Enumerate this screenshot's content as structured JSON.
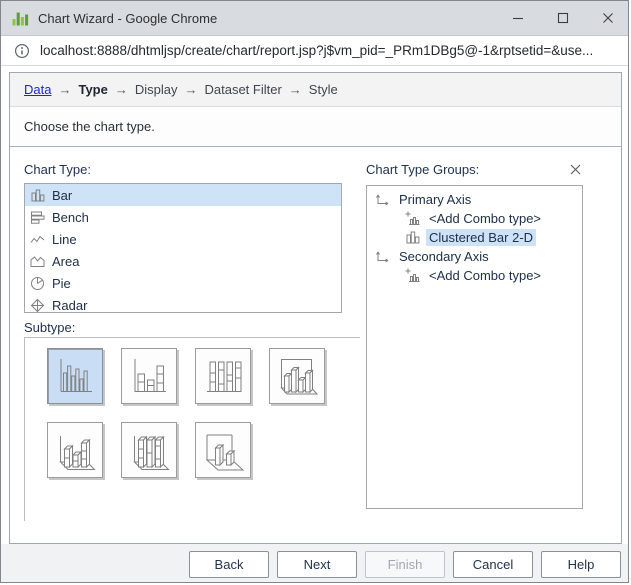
{
  "window": {
    "title": "Chart Wizard - Google Chrome",
    "favicon": "green-bar-chart-favicon",
    "controls": {
      "minimize": "minimize-icon",
      "maximize": "maximize-icon",
      "close": "close-icon"
    }
  },
  "address_bar": {
    "info_icon": "page-info-icon",
    "url": "localhost:8888/dhtmljsp/create/chart/report.jsp?j$vm_pid=_PRm1DBg5@-1&rptsetid=&use..."
  },
  "breadcrumb": {
    "separator": "→",
    "steps": [
      {
        "label": "Data",
        "state": "link"
      },
      {
        "label": "Type",
        "state": "current"
      },
      {
        "label": "Display",
        "state": "normal"
      },
      {
        "label": "Dataset Filter",
        "state": "normal"
      },
      {
        "label": "Style",
        "state": "normal"
      }
    ]
  },
  "message": "Choose the chart type.",
  "chart_type": {
    "label": "Chart Type:",
    "items": [
      {
        "label": "Bar",
        "icon": "bar-chart-icon",
        "selected": true
      },
      {
        "label": "Bench",
        "icon": "bench-chart-icon",
        "selected": false
      },
      {
        "label": "Line",
        "icon": "line-chart-icon",
        "selected": false
      },
      {
        "label": "Area",
        "icon": "area-chart-icon",
        "selected": false
      },
      {
        "label": "Pie",
        "icon": "pie-chart-icon",
        "selected": false
      },
      {
        "label": "Radar",
        "icon": "radar-chart-icon",
        "selected": false,
        "clipped": true
      }
    ]
  },
  "subtype": {
    "label": "Subtype:",
    "options": [
      {
        "name": "clustered-bar-2d",
        "selected": true
      },
      {
        "name": "stacked-bar-2d",
        "selected": false
      },
      {
        "name": "percent-stacked-bar-2d",
        "selected": false
      },
      {
        "name": "clustered-bar-3d",
        "selected": false
      },
      {
        "name": "stacked-bar-3d",
        "selected": false
      },
      {
        "name": "percent-stacked-bar-3d",
        "selected": false
      },
      {
        "name": "bar-3d",
        "selected": false
      }
    ]
  },
  "chart_type_groups": {
    "label": "Chart Type Groups:",
    "close_icon": "close-icon",
    "tree": [
      {
        "label": "Primary Axis",
        "icon": "axis-icon",
        "level": 0,
        "selected": false
      },
      {
        "label": "<Add Combo type>",
        "icon": "add-combo-icon",
        "level": 1,
        "selected": false
      },
      {
        "label": "Clustered Bar 2-D",
        "icon": "clustered-bar-icon",
        "level": 1,
        "selected": true
      },
      {
        "label": "Secondary Axis",
        "icon": "axis-icon",
        "level": 0,
        "selected": false
      },
      {
        "label": "<Add Combo type>",
        "icon": "add-combo-icon",
        "level": 1,
        "selected": false
      }
    ]
  },
  "footer": {
    "buttons": [
      {
        "label": "Back",
        "enabled": true
      },
      {
        "label": "Next",
        "enabled": true
      },
      {
        "label": "Finish",
        "enabled": false
      },
      {
        "label": "Cancel",
        "enabled": true
      },
      {
        "label": "Help",
        "enabled": true
      }
    ]
  },
  "colors": {
    "selection_highlight": "#cfe3f7",
    "subtype_selected": "#c9def5",
    "link_blue": "#2424cc",
    "favicon_green": "#6ab63f",
    "titlebar_bg": "#d8dbdf",
    "footer_bg": "#f1f2f4"
  }
}
